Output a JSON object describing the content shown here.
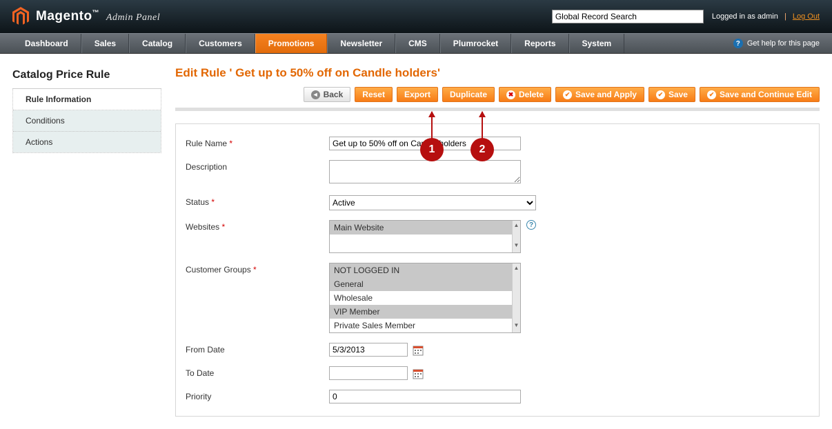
{
  "header": {
    "brand": "Magento",
    "brand_sub": "Admin Panel",
    "search_value": "Global Record Search",
    "logged_prefix": "Logged in as ",
    "logged_user": "admin",
    "logout": "Log Out"
  },
  "nav": {
    "items": [
      "Dashboard",
      "Sales",
      "Catalog",
      "Customers",
      "Promotions",
      "Newsletter",
      "CMS",
      "Plumrocket",
      "Reports",
      "System"
    ],
    "active_index": 4,
    "help": "Get help for this page"
  },
  "sidebar": {
    "title": "Catalog Price Rule",
    "items": [
      "Rule Information",
      "Conditions",
      "Actions"
    ],
    "active_index": 0
  },
  "page": {
    "title": "Edit Rule ' Get up to 50% off on Candle holders'"
  },
  "toolbar": {
    "back": "Back",
    "reset": "Reset",
    "export": "Export",
    "duplicate": "Duplicate",
    "delete": "Delete",
    "save_apply": "Save and Apply",
    "save": "Save",
    "save_continue": "Save and Continue Edit"
  },
  "form": {
    "rule_name_label": "Rule Name",
    "rule_name_value": "Get up to 50% off on Candle holders",
    "description_label": "Description",
    "description_value": "",
    "status_label": "Status",
    "status_value": "Active",
    "websites_label": "Websites",
    "websites_options": [
      "Main Website"
    ],
    "websites_selected": [
      0
    ],
    "customer_groups_label": "Customer Groups",
    "customer_groups_options": [
      "NOT LOGGED IN",
      "General",
      "Wholesale",
      "VIP Member",
      "Private Sales Member"
    ],
    "customer_groups_selected": [
      0,
      1,
      3
    ],
    "from_date_label": "From Date",
    "from_date_value": "5/3/2013",
    "to_date_label": "To Date",
    "to_date_value": "",
    "priority_label": "Priority",
    "priority_value": "0"
  },
  "callouts": {
    "one": "1",
    "two": "2"
  }
}
